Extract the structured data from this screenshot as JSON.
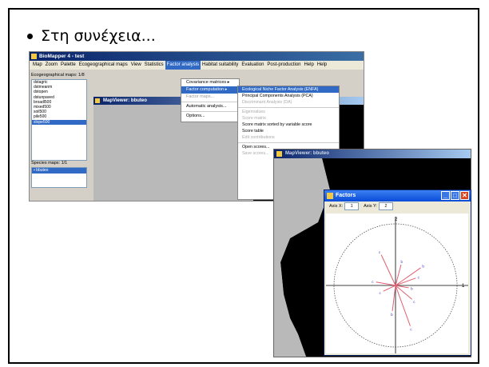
{
  "slide": {
    "bullet_text": "Στη συνέχεια..."
  },
  "app": {
    "title": "BioMapper 4 - test",
    "menu": [
      "Map",
      "Zoom",
      "Palette",
      "Ecogeographical maps",
      "View",
      "Statistics",
      "Factor analysis",
      "Habitat suitability",
      "Evaluation",
      "Post-production",
      "Help",
      "Help"
    ],
    "active_menu_index": 6,
    "ecogeo_label": "Ecogeographical maps: 1/8",
    "ecogeo_maps": [
      "dstagric",
      "dstmeanm",
      "dstopen",
      "dstunpaved",
      "broadl500",
      "mixed500",
      "soil500",
      "pile500",
      "slope500"
    ],
    "ecogeo_selected_index": 8,
    "species_label": "Species maps: 1/1",
    "species_maps": [
      "bbuteo"
    ],
    "mapviewer_title": "MapViewer: bbuteo",
    "factor_menu": [
      {
        "label": "Covariance matrices",
        "arrow": "▸",
        "state": "normal"
      },
      {
        "label": "Factor computation",
        "arrow": "▸",
        "state": "selected"
      },
      {
        "label": "Factor maps...",
        "arrow": "",
        "state": "disabled"
      },
      {
        "label": "Automatic analysis...",
        "arrow": "",
        "state": "normal",
        "sep_before": true
      },
      {
        "label": "Options...",
        "arrow": "",
        "state": "normal",
        "sep_before": true
      }
    ],
    "factor_submenu": [
      {
        "label": "Ecological Niche Factor Analysis (ENFA)",
        "state": "selected"
      },
      {
        "label": "Principal Components Analysis (PCA)",
        "state": "normal"
      },
      {
        "label": "Discriminant Analysis (DA)",
        "state": "disabled"
      },
      {
        "label": "Eigenvalues",
        "state": "disabled",
        "sep_before": true
      },
      {
        "label": "Score matrix",
        "state": "disabled"
      },
      {
        "label": "Score matrix sorted by variable score",
        "state": "normal"
      },
      {
        "label": "Score table",
        "state": "normal"
      },
      {
        "label": "Edit contributions",
        "state": "disabled"
      },
      {
        "label": "Open scores...",
        "state": "normal",
        "sep_before": true
      },
      {
        "label": "Save scores...",
        "state": "disabled"
      }
    ]
  },
  "mapviewer2": {
    "title": "MapViewer: bbuteo"
  },
  "factors_window": {
    "title": "Factors",
    "axis_x_label": "Axis X:",
    "axis_x_value": "1",
    "axis_y_label": "Axis Y:",
    "axis_y_value": "2",
    "top_axis_tick": "2",
    "right_axis_tick": "1",
    "vectors": [
      {
        "angle_deg": 115,
        "length": 0.55,
        "label": "c"
      },
      {
        "angle_deg": 75,
        "length": 0.35,
        "label": "b"
      },
      {
        "angle_deg": 35,
        "length": 0.5,
        "label": "b"
      },
      {
        "angle_deg": 20,
        "length": 0.35,
        "label": "c"
      },
      {
        "angle_deg": -10,
        "length": 0.22,
        "label": "b"
      },
      {
        "angle_deg": -40,
        "length": 0.35,
        "label": "c"
      },
      {
        "angle_deg": -70,
        "length": 0.7,
        "label": "c"
      },
      {
        "angle_deg": -97,
        "length": 0.42,
        "label": "b"
      },
      {
        "angle_deg": 170,
        "length": 0.32,
        "label": "c"
      },
      {
        "angle_deg": 205,
        "length": 0.22,
        "label": "c"
      }
    ],
    "colors": {
      "vector": "#e06070",
      "label": "#3333cc"
    }
  }
}
